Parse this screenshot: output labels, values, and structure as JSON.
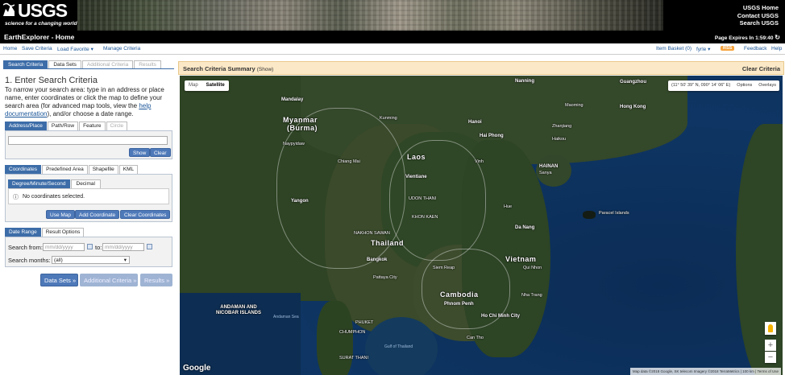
{
  "header": {
    "logo": "USGS",
    "tagline": "science for a changing world",
    "links": [
      "USGS Home",
      "Contact USGS",
      "Search USGS"
    ]
  },
  "titlebar": {
    "title": "EarthExplorer - Home",
    "expires": "Page Expires In 1:59:40"
  },
  "menu": {
    "left": [
      "Home",
      "Save Criteria",
      "Load Favorite",
      "Manage Criteria"
    ],
    "item_basket": "Item Basket (0)",
    "user": "fyrle",
    "rss": "RSS",
    "feedback": "Feedback",
    "help": "Help"
  },
  "tabs": [
    "Search Criteria",
    "Data Sets",
    "Additional Criteria",
    "Results"
  ],
  "criteria": {
    "heading": "1. Enter Search Criteria",
    "instructions_1": "To narrow your search area: type in an address or place name, enter coordinates or click the map to define your search area (for advanced map tools, view the ",
    "help_link": "help documentation",
    "instructions_2": "), and/or choose a date range."
  },
  "address_tabs": [
    "Address/Place",
    "Path/Row",
    "Feature",
    "Circle"
  ],
  "address": {
    "value": "",
    "show": "Show",
    "clear": "Clear"
  },
  "coord_tabs": [
    "Coordinates",
    "Predefined Area",
    "Shapefile",
    "KML"
  ],
  "coord_format": [
    "Degree/Minute/Second",
    "Decimal"
  ],
  "coords": {
    "message": "No coordinates selected.",
    "use_map": "Use Map",
    "add": "Add Coordinate",
    "clear": "Clear Coordinates"
  },
  "date_tabs": [
    "Date Range",
    "Result Options"
  ],
  "date": {
    "from_label": "Search from:",
    "from_placeholder": "mm/dd/yyyy",
    "to_label": "to:",
    "to_placeholder": "mm/dd/yyyy",
    "months_label": "Search months:",
    "months_value": "(all)"
  },
  "nav_buttons": [
    "Data Sets »",
    "Additional Criteria »",
    "Results »"
  ],
  "summary": {
    "title": "Search Criteria Summary",
    "show": "(Show)",
    "clear": "Clear Criteria"
  },
  "map": {
    "types": [
      "Map",
      "Satellite"
    ],
    "coord_readout": "(11° 50' 39\" N, 090° 14' 06\" E)",
    "options": "Options",
    "overlays": "Overlays",
    "zoom_in": "+",
    "zoom_out": "−",
    "google": "Google",
    "attribution": "Map data ©2018 Google, SK telecom Imagery ©2018 TerraMetrics  |  100 km  |  Terms of Use",
    "labels": {
      "myanmar": "Myanmar",
      "burma": "(Burma)",
      "laos": "Laos",
      "thailand": "Thailand",
      "cambodia": "Cambodia",
      "vietnam": "Vietnam",
      "hainan": "HAINAN",
      "mandalay": "Mandalay",
      "nanning": "Nanning",
      "guangzhou": "Guangzhou",
      "hongkong": "Hong Kong",
      "hanoi": "Hanoi",
      "haiphong": "Hai Phong",
      "vientiane": "Vientiane",
      "bangkok": "Bangkok",
      "phnompenh": "Phnom Penh",
      "hochiminh": "Ho Chi Minh City",
      "yangon": "Yangon",
      "chiangmai": "Chiang Mai",
      "danang": "Da Nang",
      "paracel": "Paracel Islands",
      "andaman": "ANDAMAN AND NICOBAR ISLANDS",
      "gulf": "Gulf of Thailand",
      "andaman_sea": "Andaman Sea",
      "quinhon": "Qui Nhon",
      "phuket": "PHUKET",
      "kunming": "Kunming",
      "naypyidaw": "Naypyidaw",
      "udon": "UDON THANI",
      "khonkaen": "KHON KAEN",
      "nakhon": "NAKHON SAWAN",
      "pattaya": "Pattaya City",
      "siemreap": "Siem Reap",
      "cantho": "Can Tho",
      "vinh": "Vinh",
      "hue": "Hue",
      "nhatrang": "Nha Trang",
      "haikou": "Haikou",
      "sanya": "Sanya",
      "maoming": "Maoming",
      "zhanjiang": "Zhanjiang",
      "suratthani": "SURAT THANI",
      "chumphon": "CHUMPHON"
    }
  }
}
